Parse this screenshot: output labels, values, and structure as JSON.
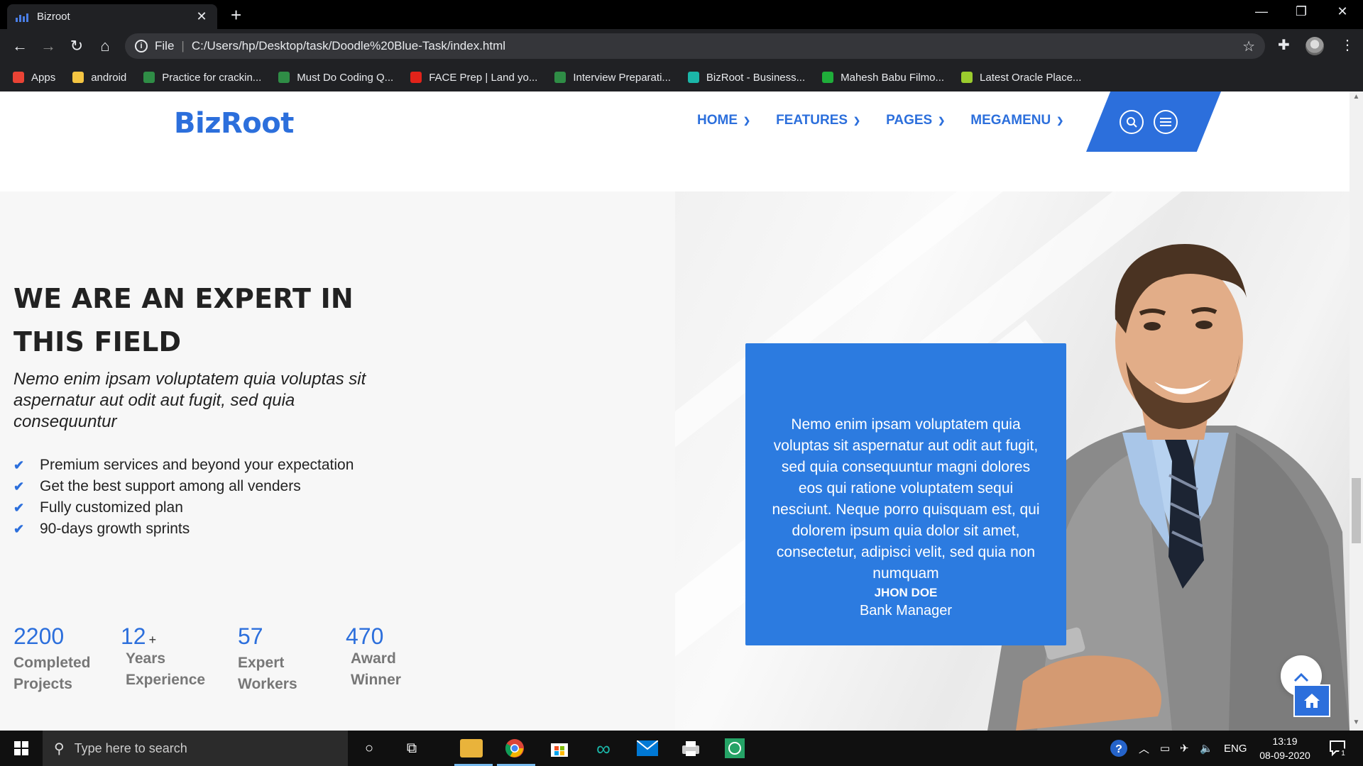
{
  "browser": {
    "tab_title": "Bizroot",
    "new_tab_symbol": "+",
    "omnibox": {
      "scheme": "File",
      "path": "C:/Users/hp/Desktop/task/Doodle%20Blue-Task/index.html"
    },
    "bookmarks": [
      {
        "label": "Apps",
        "icon": "apps-grid-icon",
        "color": "#ea4335"
      },
      {
        "label": "android",
        "icon": "folder-icon",
        "color": "#f4c542"
      },
      {
        "label": "Practice for crackin...",
        "icon": "gfg-icon",
        "color": "#2f8d46"
      },
      {
        "label": "Must Do Coding Q...",
        "icon": "gfg-icon",
        "color": "#2f8d46"
      },
      {
        "label": "FACE Prep | Land yo...",
        "icon": "faceprep-icon",
        "color": "#e2231a"
      },
      {
        "label": "Interview Preparati...",
        "icon": "gfg-icon",
        "color": "#2f8d46"
      },
      {
        "label": "BizRoot - Business...",
        "icon": "bizroot-icon",
        "color": "#1bb6a8"
      },
      {
        "label": "Mahesh Babu Filmo...",
        "icon": "tr-icon",
        "color": "#1fae3a"
      },
      {
        "label": "Latest Oracle Place...",
        "icon": "oracle-icon",
        "color": "#9bcc2e"
      }
    ]
  },
  "site": {
    "logo": "BizRoot",
    "nav": [
      {
        "label": "HOME"
      },
      {
        "label": "FEATURES"
      },
      {
        "label": "PAGES"
      },
      {
        "label": "MEGAMENU"
      }
    ],
    "accent_color": "#2c6fdc"
  },
  "about": {
    "heading": "WE ARE AN EXPERT IN THIS FIELD",
    "subtitle": "Nemo enim ipsam voluptatem quia voluptas sit aspernatur aut odit aut fugit, sed quia consequuntur",
    "features": [
      "Premium services and beyond your expectation",
      "Get the best support among all venders",
      "Fully customized plan",
      "90-days growth sprints"
    ],
    "stats": [
      {
        "value": "2200",
        "suffix": "",
        "label_1": "Completed",
        "label_2": "Projects"
      },
      {
        "value": "12",
        "suffix": "+",
        "label_1": "Years",
        "label_2": "Experience"
      },
      {
        "value": "57",
        "suffix": "",
        "label_1": "Expert",
        "label_2": "Workers"
      },
      {
        "value": "470",
        "suffix": "",
        "label_1": "Award",
        "label_2": "Winner"
      }
    ]
  },
  "testimonial": {
    "text": "Nemo enim ipsam voluptatem quia voluptas sit aspernatur aut odit aut fugit, sed quia consequuntur magni dolores eos qui ratione voluptatem sequi nesciunt. Neque porro quisquam est, qui dolorem ipsum quia dolor sit amet, consectetur, adipisci velit, sed quia non numquam",
    "name": "JHON DOE",
    "role": "Bank Manager"
  },
  "taskbar": {
    "search_placeholder": "Type here to search",
    "language": "ENG",
    "time": "13:19",
    "date": "08-09-2020",
    "notification_count": "1"
  }
}
